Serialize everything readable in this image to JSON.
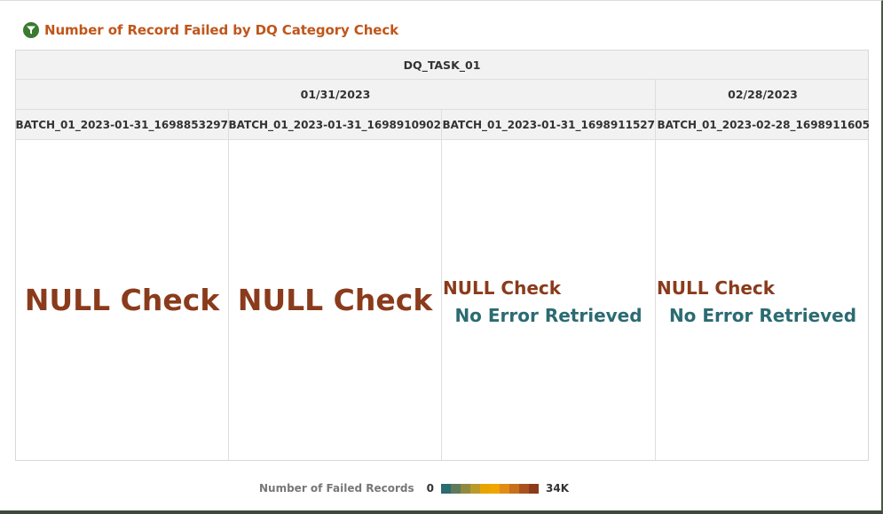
{
  "title": {
    "text": "Number of Record Failed by DQ Category Check",
    "icon": "funnel-icon"
  },
  "grid": {
    "task_label": "DQ_TASK_01",
    "dates": [
      "01/31/2023",
      "02/28/2023"
    ],
    "runs": [
      "BATCH_01_2023-01-31_1698853297",
      "BATCH_01_2023-01-31_1698910902",
      "BATCH_01_2023-01-31_1698911527",
      "BATCH_01_2023-02-28_1698911605"
    ],
    "cells": [
      {
        "category": "NULL Check",
        "status": ""
      },
      {
        "category": "NULL Check",
        "status": ""
      },
      {
        "category": "NULL Check",
        "status": "No Error Retrieved"
      },
      {
        "category": "NULL Check",
        "status": "No Error Retrieved"
      }
    ]
  },
  "legend": {
    "title": "Number of Failed Records",
    "min": "0",
    "max": "34K",
    "colors": [
      "#2b6b72",
      "#5e7a5a",
      "#8f8a3e",
      "#b99a2a",
      "#e8a400",
      "#f0a500",
      "#e18c16",
      "#c6701c",
      "#a9521e",
      "#8a3b1c"
    ]
  },
  "colors": {
    "title": "#c0561b",
    "failed_text": "#8a3b1c",
    "no_error_text": "#2b6b72",
    "header_bg": "#f2f2f2"
  }
}
